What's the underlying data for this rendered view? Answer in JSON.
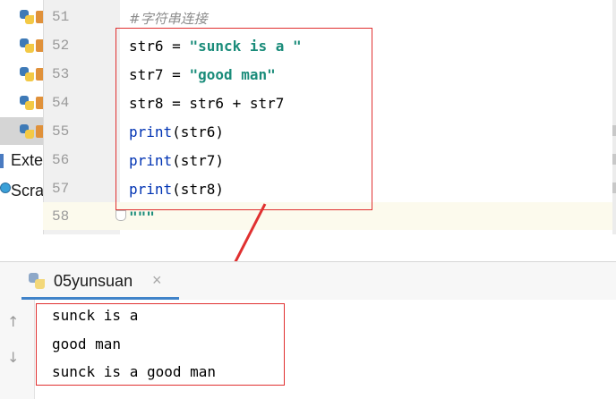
{
  "project": {
    "rows": [
      {
        "text": ""
      },
      {
        "text": ""
      },
      {
        "text": ""
      },
      {
        "text": ""
      },
      {
        "text": ""
      }
    ],
    "external_label": "Exte",
    "scratches_label": "Scra"
  },
  "editor": {
    "lines": [
      {
        "num": "51",
        "text": "#字符串连接"
      },
      {
        "num": "52",
        "code": {
          "var": "str6 = ",
          "str": "\"sunck is a \""
        }
      },
      {
        "num": "53",
        "code": {
          "var": "str7 = ",
          "str": "\"good man\""
        }
      },
      {
        "num": "54",
        "code": {
          "var": "str8 = str6 + str7"
        }
      },
      {
        "num": "55",
        "code": {
          "fn": "print",
          "rest": "(str6)"
        }
      },
      {
        "num": "56",
        "code": {
          "fn": "print",
          "rest": "(str7)"
        }
      },
      {
        "num": "57",
        "code": {
          "fn": "print",
          "rest": "(str8)"
        }
      },
      {
        "num": "58",
        "code": {
          "str": "\"\"\""
        }
      }
    ]
  },
  "run": {
    "tab_label": "05yunsuan",
    "close": "×",
    "up_arrow": "↑",
    "down_arrow": "↓",
    "output": [
      "sunck is a",
      "good man",
      "sunck is a good man"
    ]
  },
  "colors": {
    "annotation_red": "#e03030",
    "string_teal": "#1a8c7a",
    "builtin_blue": "#0033b3",
    "tab_underline": "#4083c9"
  },
  "icons": [
    "python-file-icon",
    "external-libraries-icon",
    "scratches-icon",
    "fold-icon",
    "close-icon",
    "up-arrow-icon",
    "down-arrow-icon"
  ]
}
